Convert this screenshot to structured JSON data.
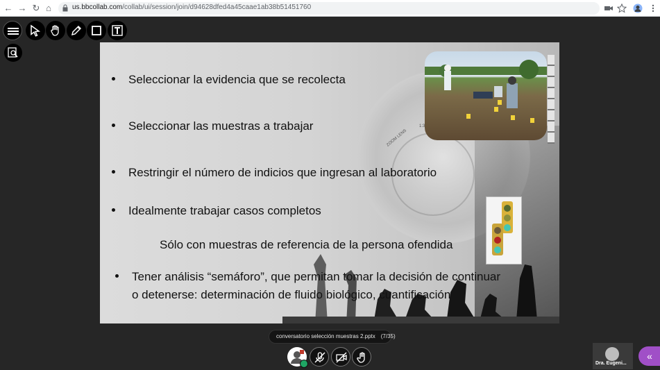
{
  "browser": {
    "url_host": "us.bbcollab.com",
    "url_path": "/collab/ui/session/join/d94628dfed4a45caae1ab38b51451760",
    "back": "←",
    "forward": "→",
    "reload": "↻",
    "home": "⌂"
  },
  "toolbar": {
    "tools": [
      "menu-icon",
      "select-icon",
      "pan-icon",
      "pen-icon",
      "shape-icon",
      "text-icon"
    ],
    "zoom_tool": "zoom-page-icon"
  },
  "slide": {
    "bullets": [
      "Seleccionar la evidencia que se recolecta",
      "Seleccionar las muestras a trabajar",
      "Restringir el número de indicios que ingresan al laboratorio",
      "Idealmente trabajar casos completos"
    ],
    "subtext": "Sólo con muestras de referencia de la persona ofendida",
    "last_bullet_line1": "Tener análisis “semáforo”, que permitan tomar la decisión de continuar",
    "last_bullet_line2": "o detenerse: determinación de fluido biológico, cuantificación",
    "lens_text_1": "ZOOM LENS",
    "lens_text_2": "1:3.5"
  },
  "status": {
    "file_name": "conversatorio selección muestras 2.pptx",
    "page": "(7/35)"
  },
  "controls": [
    "avatar-status",
    "microphone-muted-icon",
    "camera-off-icon",
    "raise-hand-icon"
  ],
  "presenter": {
    "name": "Dra. Eugeni..."
  },
  "colors": {
    "accent": "#a04fc7",
    "status_green": "#1fa564",
    "background": "#262626"
  }
}
